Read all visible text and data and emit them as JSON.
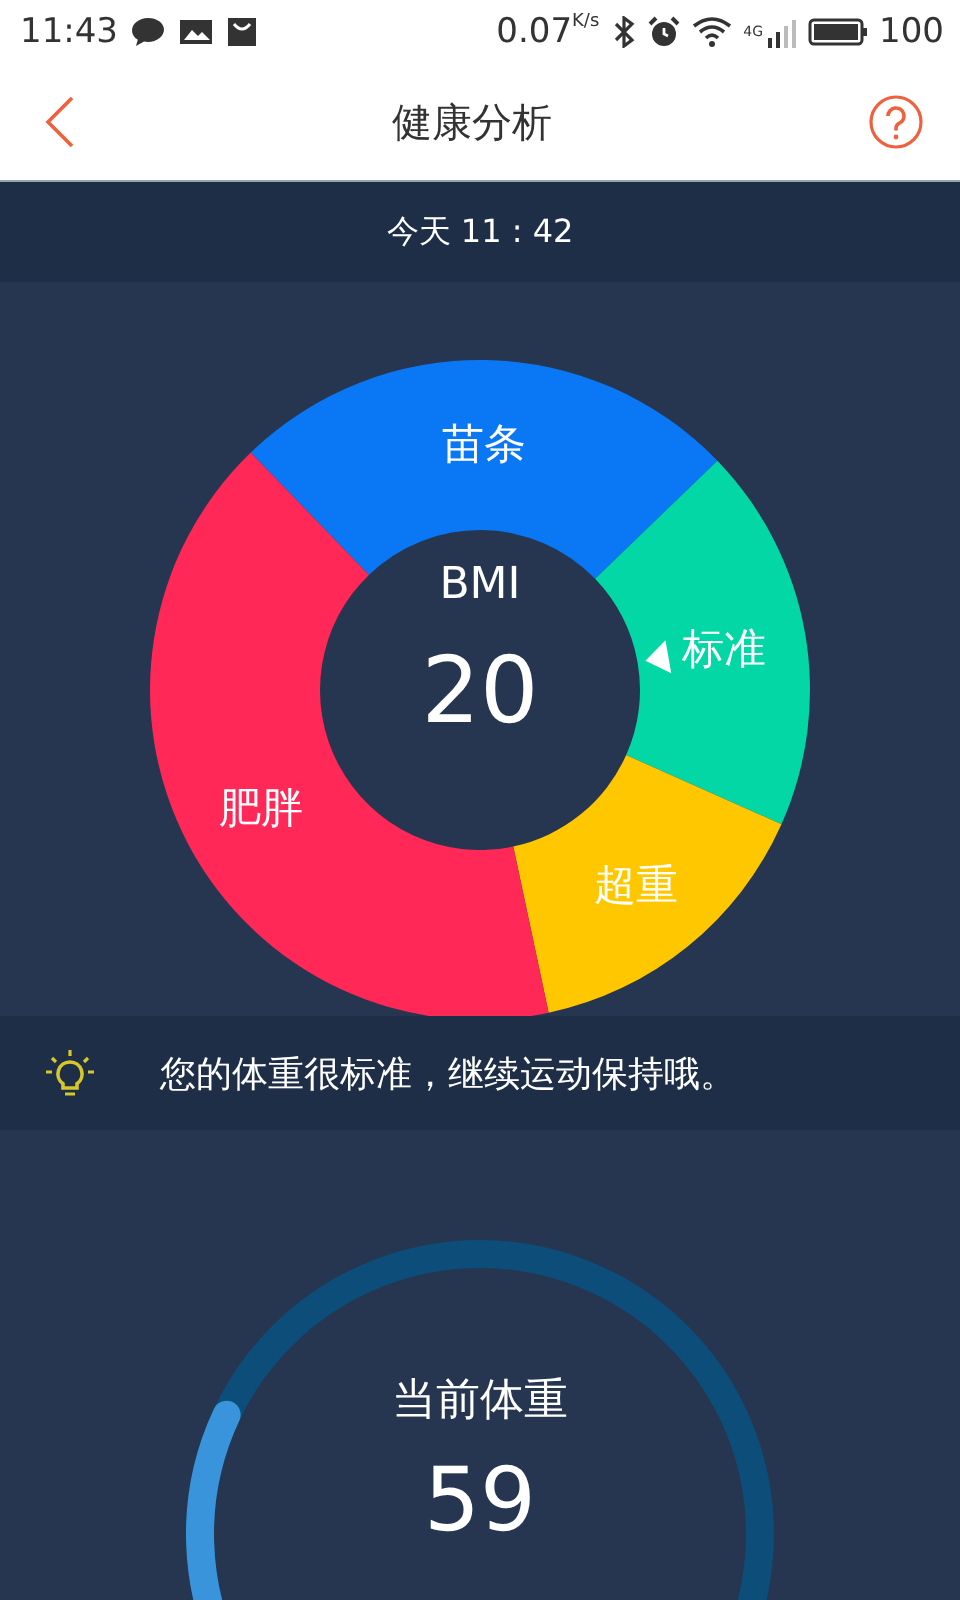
{
  "status_bar": {
    "time": "11:43",
    "speed": "0.07",
    "speed_unit": "K/s",
    "network": "4G",
    "battery": "100"
  },
  "header": {
    "title": "健康分析"
  },
  "date": "今天  11 : 42",
  "bmi": {
    "label": "BMI",
    "value": "20",
    "segments": [
      {
        "name": "苗条",
        "color": "#0a78f5",
        "selected": false
      },
      {
        "name": "标准",
        "color": "#03d7a6",
        "selected": true
      },
      {
        "name": "超重",
        "color": "#ffc700",
        "selected": false
      },
      {
        "name": "肥胖",
        "color": "#ff2856",
        "selected": false
      }
    ]
  },
  "tip": "您的体重很标准，继续运动保持哦。",
  "weight": {
    "label": "当前体重",
    "value": "59",
    "level": 0.32
  }
}
